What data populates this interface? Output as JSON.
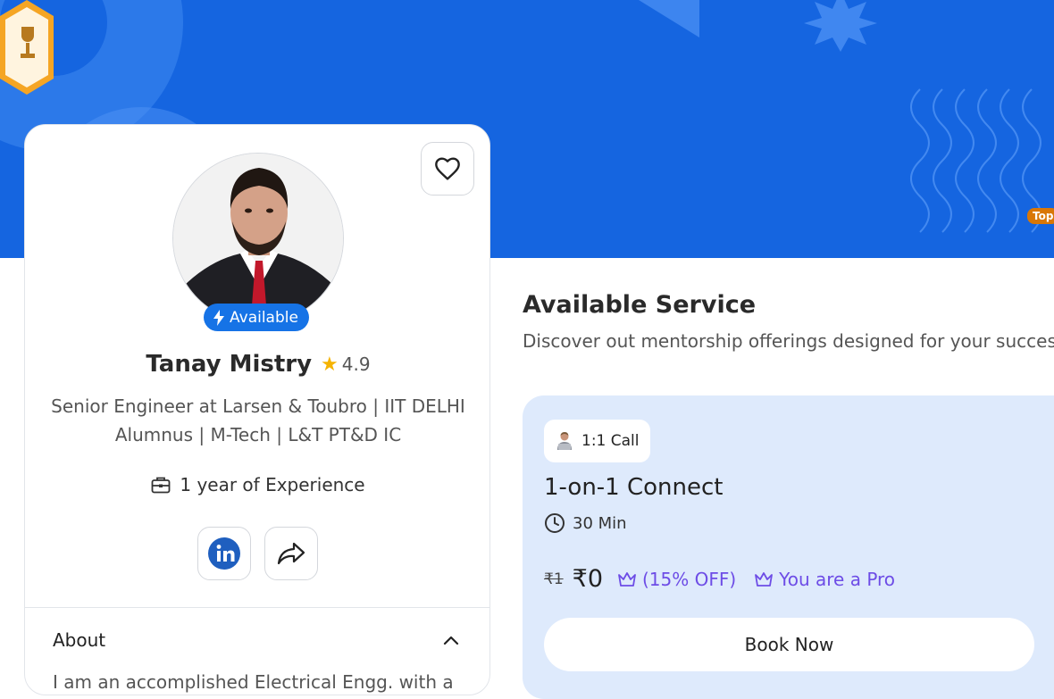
{
  "banner": {
    "trophy_tag": "Top",
    "colors": {
      "background": "#1565e0",
      "accent": "#4f93f5"
    }
  },
  "profile": {
    "favorite_icon": "heart-icon",
    "available_label": "Available",
    "name": "Tanay Mistry",
    "rating": "4.9",
    "headline_line1": "Senior Engineer at Larsen & Toubro | IIT DELHI",
    "headline_line2": "Alumnus | M-Tech | L&T PT&D IC",
    "experience": "1 year of Experience",
    "social": [
      {
        "icon": "linkedin-icon"
      },
      {
        "icon": "share-icon"
      }
    ],
    "about_title": "About",
    "about_text": "I am an accomplished Electrical Engg. with a"
  },
  "services": {
    "title": "Available Service",
    "subtitle": "Discover out mentorship offerings designed for your success",
    "cards": [
      {
        "type_label": "1:1 Call",
        "name": "1-on-1 Connect",
        "duration": "30 Min",
        "old_price": "₹1",
        "new_price": "₹0",
        "discount": "(15% OFF)",
        "pro_label": "You are a Pro",
        "button": "Book Now"
      }
    ]
  }
}
